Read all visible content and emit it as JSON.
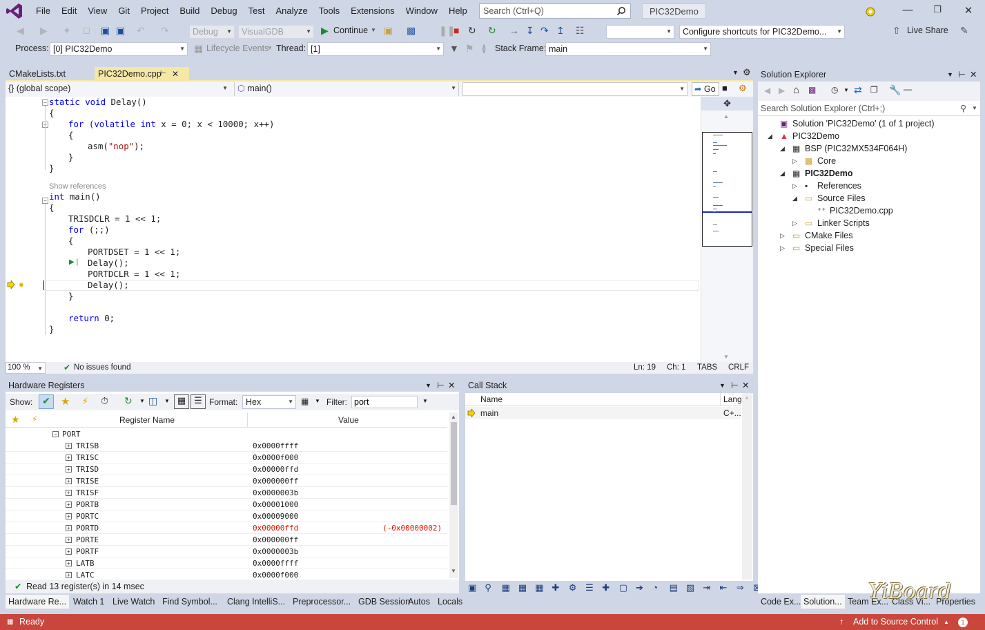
{
  "menu": [
    "File",
    "Edit",
    "View",
    "Git",
    "Project",
    "Build",
    "Debug",
    "Test",
    "Analyze",
    "Tools",
    "Extensions",
    "Window",
    "Help"
  ],
  "search": {
    "placeholder": "Search (Ctrl+Q)"
  },
  "solution_title": "PIC32Demo",
  "toolbar": {
    "config": "Debug",
    "platform": "VisualGDB",
    "continue_label": "Continue",
    "shortcut_combo": "Configure shortcuts for PIC32Demo...",
    "live_share": "Live Share"
  },
  "debugbar": {
    "process_label": "Process:",
    "process_value": "[0] PIC32Demo",
    "lifecycle": "Lifecycle Events",
    "thread_label": "Thread:",
    "thread_value": "[1]",
    "stackframe_label": "Stack Frame:",
    "stackframe_value": "main"
  },
  "doc_tabs": [
    {
      "label": "CMakeLists.txt",
      "active": false
    },
    {
      "label": "PIC32Demo.cpp",
      "active": true
    }
  ],
  "navbar": {
    "scope": "{} (global scope)",
    "function": "main()",
    "third": "",
    "go": "Go"
  },
  "code": {
    "lines": [
      {
        "kind": "code",
        "parts": [
          [
            "kw",
            "static void"
          ],
          [
            "t",
            " Delay()"
          ]
        ],
        "indent": 0
      },
      {
        "kind": "code",
        "parts": [
          [
            "t",
            "{"
          ]
        ],
        "indent": 0
      },
      {
        "kind": "code",
        "parts": [
          [
            "kw",
            "for"
          ],
          [
            "t",
            " ("
          ],
          [
            "kw",
            "volatile int"
          ],
          [
            "t",
            " x = 0; x < 10000; x++)"
          ]
        ],
        "indent": 1
      },
      {
        "kind": "code",
        "parts": [
          [
            "t",
            "{"
          ]
        ],
        "indent": 1
      },
      {
        "kind": "code",
        "parts": [
          [
            "t",
            "asm("
          ],
          [
            "str",
            "\"nop\""
          ],
          [
            "t",
            ");"
          ]
        ],
        "indent": 2
      },
      {
        "kind": "code",
        "parts": [
          [
            "t",
            "}"
          ]
        ],
        "indent": 1
      },
      {
        "kind": "code",
        "parts": [
          [
            "t",
            "}"
          ]
        ],
        "indent": 0
      }
    ],
    "show_references": "Show references",
    "main_lines": [
      {
        "parts": [
          [
            "kw",
            "int"
          ],
          [
            "t",
            " main()"
          ]
        ],
        "indent": 0
      },
      {
        "parts": [
          [
            "t",
            "{"
          ]
        ],
        "indent": 0
      },
      {
        "parts": [
          [
            "t",
            "TRISDCLR = 1 << 1;"
          ]
        ],
        "indent": 1
      },
      {
        "parts": [
          [
            "kw",
            "for"
          ],
          [
            "t",
            " (;;)"
          ]
        ],
        "indent": 1
      },
      {
        "parts": [
          [
            "t",
            "{"
          ]
        ],
        "indent": 1
      },
      {
        "parts": [
          [
            "t",
            "PORTDSET = 1 << 1;"
          ]
        ],
        "indent": 2
      },
      {
        "parts": [
          [
            "t",
            "Delay();"
          ]
        ],
        "indent": 2
      },
      {
        "parts": [
          [
            "t",
            "PORTDCLR = 1 << 1;"
          ]
        ],
        "indent": 2
      },
      {
        "parts": [
          [
            "t",
            "Delay();"
          ]
        ],
        "indent": 2
      },
      {
        "parts": [
          [
            "t",
            "}"
          ]
        ],
        "indent": 1
      },
      {
        "parts": [
          [
            "t",
            ""
          ]
        ],
        "indent": 1
      },
      {
        "parts": [
          [
            "kw",
            "return"
          ],
          [
            "t",
            " 0;"
          ]
        ],
        "indent": 1
      },
      {
        "parts": [
          [
            "t",
            "}"
          ]
        ],
        "indent": 0
      }
    ]
  },
  "editor_status": {
    "zoom": "100 %",
    "issues": "No issues found",
    "ln": "Ln: 19",
    "ch": "Ch: 1",
    "tabs": "TABS",
    "crlf": "CRLF"
  },
  "hw": {
    "title": "Hardware Registers",
    "show_label": "Show:",
    "format_label": "Format:",
    "format_value": "Hex",
    "filter_label": "Filter:",
    "filter_value": "port",
    "col_name": "Register Name",
    "col_value": "Value",
    "group": "PORT",
    "rows": [
      {
        "name": "TRISB",
        "value": "0x0000ffff",
        "delta": ""
      },
      {
        "name": "TRISC",
        "value": "0x0000f000",
        "delta": ""
      },
      {
        "name": "TRISD",
        "value": "0x00000ffd",
        "delta": ""
      },
      {
        "name": "TRISE",
        "value": "0x000000ff",
        "delta": ""
      },
      {
        "name": "TRISF",
        "value": "0x0000003b",
        "delta": ""
      },
      {
        "name": "PORTB",
        "value": "0x00001000",
        "delta": ""
      },
      {
        "name": "PORTC",
        "value": "0x00009000",
        "delta": ""
      },
      {
        "name": "PORTD",
        "value": "0x00000ffd",
        "delta": "(-0x00000002)"
      },
      {
        "name": "PORTE",
        "value": "0x000000ff",
        "delta": ""
      },
      {
        "name": "PORTF",
        "value": "0x0000003b",
        "delta": ""
      },
      {
        "name": "LATB",
        "value": "0x0000ffff",
        "delta": ""
      },
      {
        "name": "LATC",
        "value": "0x0000f000",
        "delta": ""
      }
    ],
    "status": "Read 13 register(s) in 14 msec"
  },
  "callstack": {
    "title": "Call Stack",
    "col_name": "Name",
    "col_lang": "Lang",
    "rows": [
      {
        "name": "main",
        "lang": "C+..."
      }
    ]
  },
  "solution_explorer": {
    "title": "Solution Explorer",
    "search_placeholder": "Search Solution Explorer (Ctrl+;)",
    "items": [
      {
        "label": "Solution 'PIC32Demo' (1 of 1 project)",
        "level": 0,
        "arrow": "",
        "bold": false
      },
      {
        "label": "PIC32Demo",
        "level": 0,
        "arrow": "down",
        "bold": false
      },
      {
        "label": "BSP (PIC32MX534F064H)",
        "level": 1,
        "arrow": "down",
        "bold": false
      },
      {
        "label": "Core",
        "level": 2,
        "arrow": "right",
        "bold": false
      },
      {
        "label": "PIC32Demo",
        "level": 1,
        "arrow": "down",
        "bold": true
      },
      {
        "label": "References",
        "level": 2,
        "arrow": "right",
        "bold": false
      },
      {
        "label": "Source Files",
        "level": 2,
        "arrow": "down",
        "bold": false
      },
      {
        "label": "PIC32Demo.cpp",
        "level": 3,
        "arrow": "",
        "bold": false
      },
      {
        "label": "Linker Scripts",
        "level": 2,
        "arrow": "right",
        "bold": false
      },
      {
        "label": "CMake Files",
        "level": 1,
        "arrow": "right",
        "bold": false
      },
      {
        "label": "Special Files",
        "level": 1,
        "arrow": "right",
        "bold": false
      }
    ]
  },
  "bottom_tabs_left": [
    "Hardware Re...",
    "Watch 1",
    "Live Watch",
    "Find Symbol...",
    "Clang IntelliS...",
    "Preprocessor...",
    "GDB Session",
    "Autos",
    "Locals"
  ],
  "bottom_tabs_right": [
    "Code Ex...",
    "Solution...",
    "Team Ex...",
    "Class Vi...",
    "Properties"
  ],
  "statusbar": {
    "ready": "Ready",
    "source_control": "Add to Source Control",
    "badge": "1"
  },
  "watermark": "YiBoard",
  "colors": {
    "accent": "#68217a",
    "statusbar": "#c9463d",
    "changed": "#e51400"
  }
}
